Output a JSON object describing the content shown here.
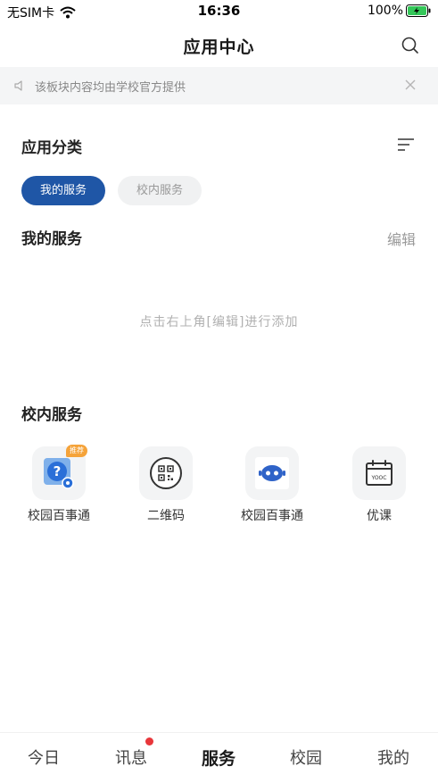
{
  "status_bar": {
    "carrier": "无SIM卡",
    "time": "16:36",
    "battery": "100%"
  },
  "header": {
    "title": "应用中心"
  },
  "notice": {
    "text": "该板块内容均由学校官方提供"
  },
  "categories": {
    "title": "应用分类",
    "chips": [
      {
        "label": "我的服务"
      },
      {
        "label": "校内服务"
      }
    ]
  },
  "my_services": {
    "title": "我的服务",
    "edit_label": "编辑",
    "empty_hint": "点击右上角[编辑]进行添加"
  },
  "campus_services": {
    "title": "校内服务",
    "apps": [
      {
        "label": "校园百事通",
        "badge": "推荐"
      },
      {
        "label": "二维码"
      },
      {
        "label": "校园百事通"
      },
      {
        "label": "优课",
        "icon_text": "YOOC"
      }
    ]
  },
  "tab_bar": {
    "tabs": [
      {
        "label": "今日"
      },
      {
        "label": "讯息"
      },
      {
        "label": "服务"
      },
      {
        "label": "校园"
      },
      {
        "label": "我的"
      }
    ]
  },
  "colors": {
    "accent": "#1f56a6",
    "badge": "#f5a33a",
    "notification_dot": "#e8363a"
  }
}
